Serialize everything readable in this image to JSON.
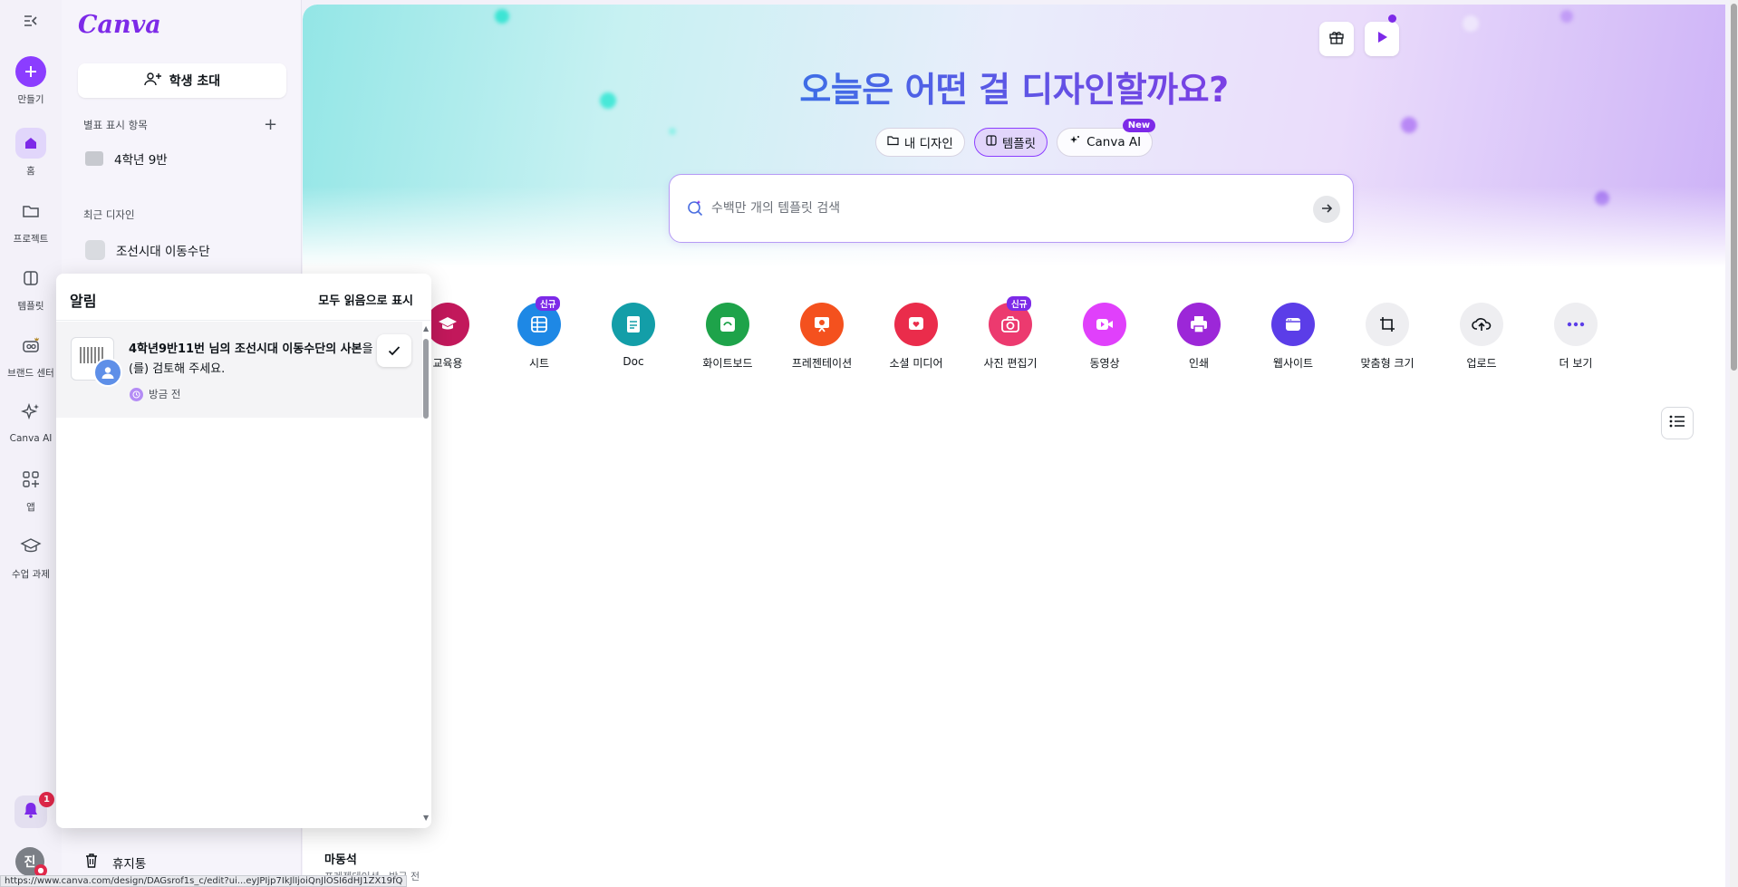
{
  "rail": {
    "items": [
      {
        "label": "만들기"
      },
      {
        "label": "홈"
      },
      {
        "label": "프로젝트"
      },
      {
        "label": "템플릿"
      },
      {
        "label": "브랜드 센터"
      },
      {
        "label": "Canva AI"
      },
      {
        "label": "앱"
      },
      {
        "label": "수업 과제"
      }
    ],
    "notification_count": "1",
    "avatar_initial": "진"
  },
  "panel": {
    "logo": "Canva",
    "invite_label": "학생 초대",
    "starred_title": "별표 표시 항목",
    "starred_items": [
      {
        "label": "4학년 9반"
      }
    ],
    "recent_title": "최근 디자인",
    "recent_items": [
      {
        "label": "조선시대 이동수단"
      }
    ],
    "trash_label": "휴지통"
  },
  "hero": {
    "title": "오늘은 어떤 걸 디자인할까요?",
    "tabs": [
      {
        "label": "내 디자인",
        "active": false
      },
      {
        "label": "템플릿",
        "active": true
      },
      {
        "label": "Canva AI",
        "badge": "New",
        "active": false
      }
    ],
    "search_placeholder": "수백만 개의 템플릿 검색"
  },
  "categories": [
    {
      "label": "교육용",
      "color": "#c2185b",
      "icon": "graduation-cap-icon"
    },
    {
      "label": "시트",
      "color": "#1e88e5",
      "icon": "sheet-icon",
      "badge": "신규"
    },
    {
      "label": "Doc",
      "color": "#139ea8",
      "icon": "doc-icon"
    },
    {
      "label": "화이트보드",
      "color": "#1ea34a",
      "icon": "whiteboard-icon"
    },
    {
      "label": "프레젠테이션",
      "color": "#f4511e",
      "icon": "presentation-icon"
    },
    {
      "label": "소셜 미디어",
      "color": "#ea2c4b",
      "icon": "social-media-icon"
    },
    {
      "label": "사진 편집기",
      "color": "#ec3a6f",
      "icon": "camera-icon",
      "badge": "신규"
    },
    {
      "label": "동영상",
      "color": "#e040fb",
      "icon": "video-icon"
    },
    {
      "label": "인쇄",
      "color": "#9c27d8",
      "icon": "print-icon"
    },
    {
      "label": "웹사이트",
      "color": "#5b3de8",
      "icon": "website-icon"
    },
    {
      "label": "맞춤형 크기",
      "color": "#eeeef1",
      "icon": "custom-size-icon"
    },
    {
      "label": "업로드",
      "color": "#eeeef1",
      "icon": "upload-icon"
    },
    {
      "label": "더 보기",
      "color": "#eeeef1",
      "icon": "more-icon"
    }
  ],
  "notifications": {
    "title": "알림",
    "mark_all_read": "모두 읽음으로 표시",
    "items": [
      {
        "text_bold": "4학년9반11번 님의 조선시대 이동수단의 사본",
        "text_rest": "을(를) 검토해 주세요.",
        "time": "방금 전"
      }
    ]
  },
  "bottom_card": {
    "title": "마동석",
    "subtitle": "프레젠테이션 · 방금 전"
  },
  "status_url": "https://www.canva.com/design/DAGsrof1s_c/edit?ui...eyJPIjp7IkJlIjoiQnJlOSI6dHJ1ZX19fQ"
}
